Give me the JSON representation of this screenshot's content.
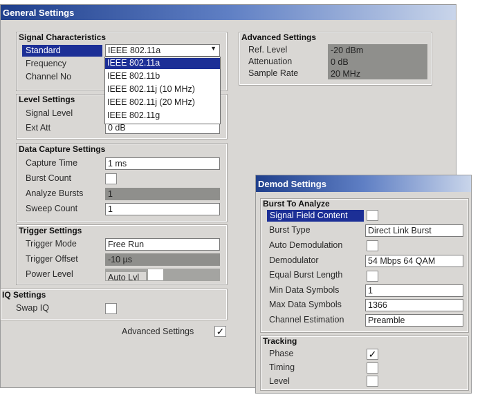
{
  "main": {
    "title": "General Settings"
  },
  "signal": {
    "header": "Signal Characteristics",
    "standard_label": "Standard",
    "standard_value": "IEEE 802.11a",
    "frequency_label": "Frequency",
    "channel_label": "Channel No",
    "dropdown_options": [
      "IEEE 802.11a",
      "IEEE 802.11b",
      "IEEE 802.11j (10 MHz)",
      "IEEE 802.11j (20 MHz)",
      "IEEE 802.11g"
    ]
  },
  "level": {
    "header": "Level Settings",
    "signal_level_label": "Signal Level",
    "ext_att_label": "Ext Att",
    "ext_att_value": "0 dB"
  },
  "capture": {
    "header": "Data Capture Settings",
    "capture_time_label": "Capture Time",
    "capture_time_value": "1 ms",
    "burst_count_label": "Burst Count",
    "analyze_bursts_label": "Analyze Bursts",
    "analyze_bursts_value": "1",
    "sweep_count_label": "Sweep Count",
    "sweep_count_value": "1"
  },
  "trigger": {
    "header": "Trigger Settings",
    "mode_label": "Trigger Mode",
    "mode_value": "Free Run",
    "offset_label": "Trigger Offset",
    "offset_value": "-10 µs",
    "power_label": "Power Level",
    "power_value": "Auto Lvl"
  },
  "iq": {
    "header": "IQ Settings",
    "swap_label": "Swap IQ"
  },
  "advanced_toggle": {
    "label": "Advanced Settings",
    "check": "✓"
  },
  "advanced": {
    "header": "Advanced Settings",
    "ref_level_label": "Ref. Level",
    "ref_level_value": "-20 dBm",
    "attenuation_label": "Attenuation",
    "attenuation_value": "0 dB",
    "sample_rate_label": "Sample Rate",
    "sample_rate_value": "20 MHz"
  },
  "demod": {
    "title": "Demod Settings",
    "burst_header": "Burst To Analyze",
    "signal_field_label": "Signal Field Content",
    "burst_type_label": "Burst Type",
    "burst_type_value": "Direct Link Burst",
    "auto_demod_label": "Auto Demodulation",
    "demodulator_label": "Demodulator",
    "demodulator_value": "54 Mbps 64 QAM",
    "equal_burst_label": "Equal Burst Length",
    "min_symbols_label": "Min Data Symbols",
    "min_symbols_value": "1",
    "max_symbols_label": "Max Data Symbols",
    "max_symbols_value": "1366",
    "chan_est_label": "Channel Estimation",
    "chan_est_value": "Preamble",
    "tracking_header": "Tracking",
    "phase_label": "Phase",
    "phase_check": "✓",
    "timing_label": "Timing",
    "level_label": "Level"
  },
  "icons": {
    "dropdown": "chevron-down-icon",
    "check": "checkmark-icon"
  },
  "colors": {
    "titlebar_dark": "#1f3f8c",
    "selection": "#1c2f96",
    "panel": "#d9d7d4",
    "readonly": "#8f8f8c"
  }
}
